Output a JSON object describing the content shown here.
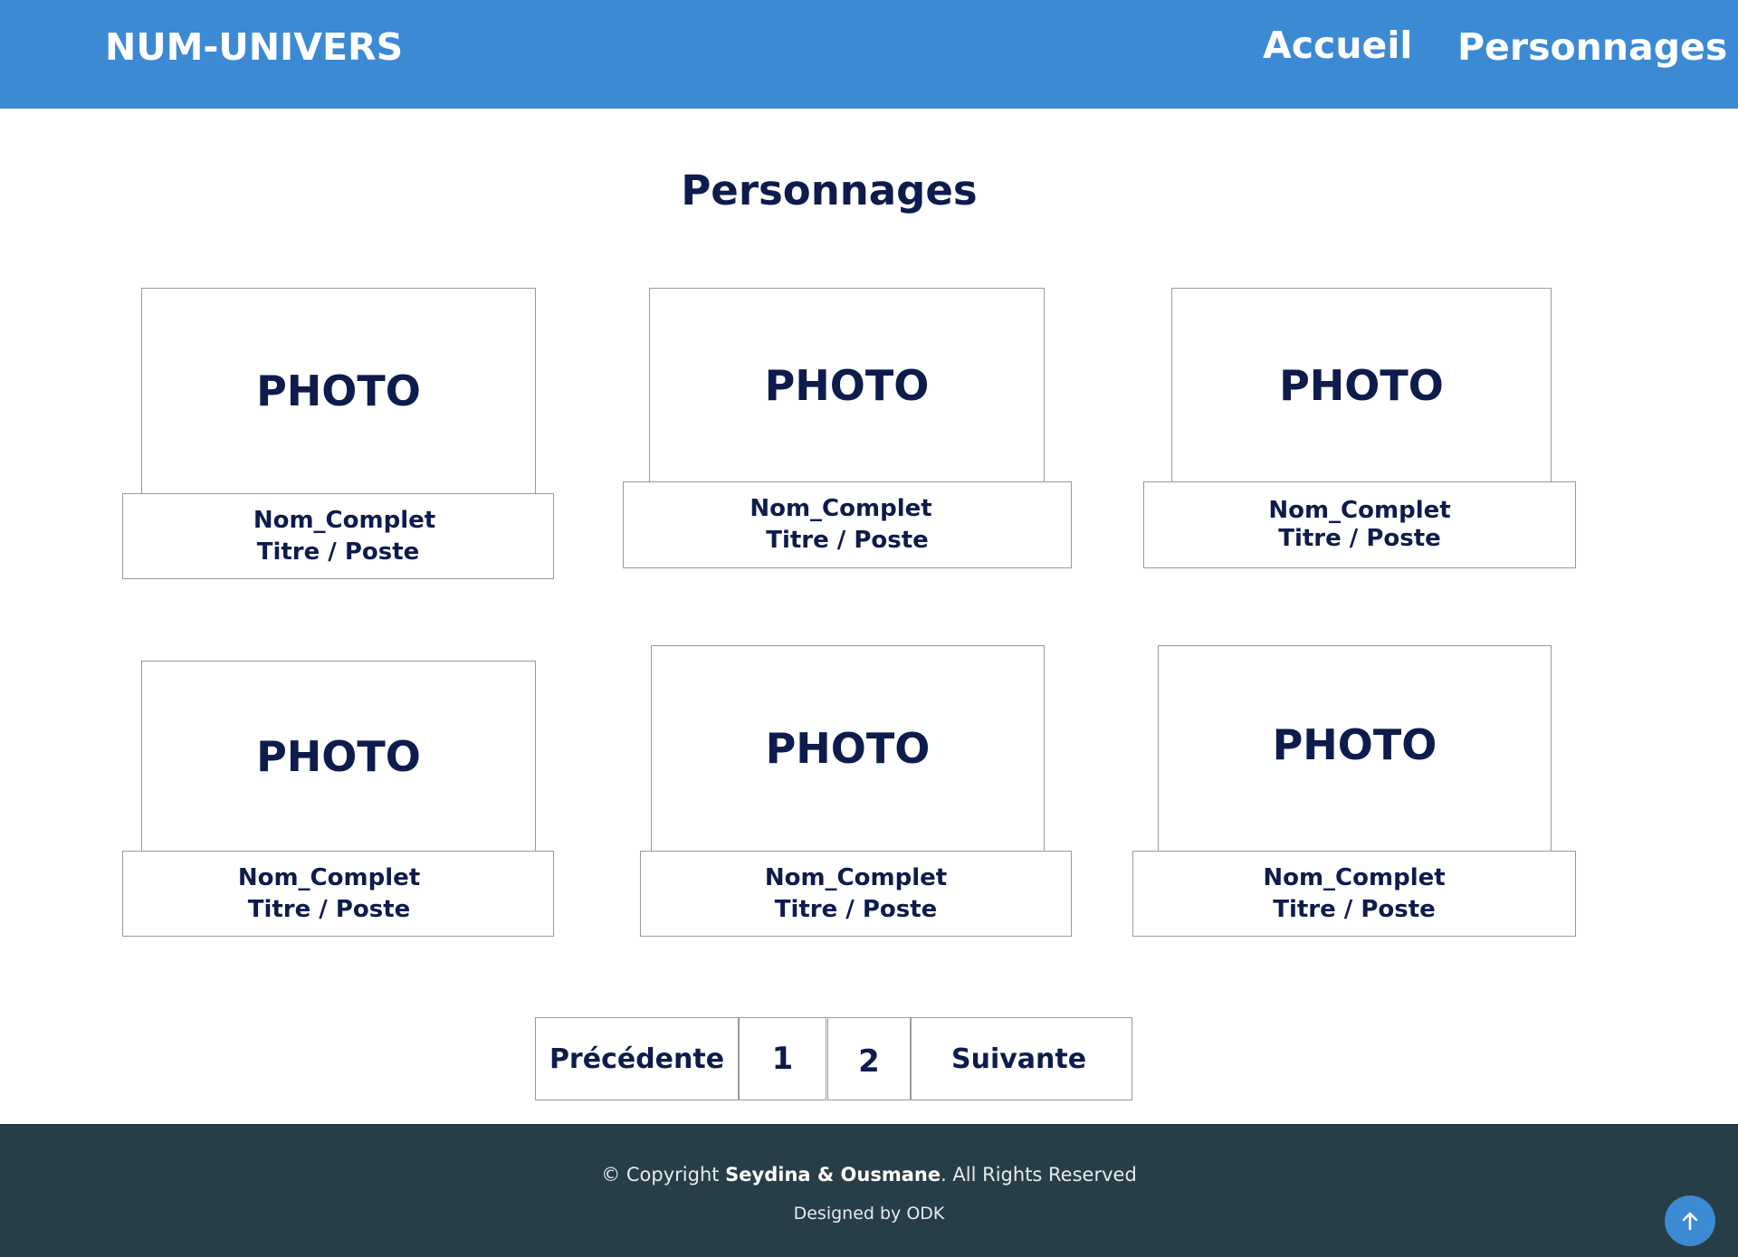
{
  "header": {
    "brand": "NUM-UNIVERS",
    "nav": [
      {
        "label": "Accueil"
      },
      {
        "label": "Personnages"
      }
    ]
  },
  "main": {
    "title": "Personnages",
    "cards": [
      {
        "photo": "PHOTO",
        "name": "Nom_Complet",
        "role": "Titre / Poste"
      },
      {
        "photo": "PHOTO",
        "name": "Nom_Complet",
        "role": "Titre / Poste"
      },
      {
        "photo": "PHOTO",
        "name": "Nom_Complet",
        "role": "Titre / Poste"
      },
      {
        "photo": "PHOTO",
        "name": "Nom_Complet",
        "role": "Titre / Poste"
      },
      {
        "photo": "PHOTO",
        "name": "Nom_Complet",
        "role": "Titre / Poste"
      },
      {
        "photo": "PHOTO",
        "name": "Nom_Complet",
        "role": "Titre / Poste"
      }
    ]
  },
  "pagination": {
    "previous": "Précédente",
    "page1": "1",
    "page2": "2",
    "next": "Suivante"
  },
  "footer": {
    "copyright_prefix": "© Copyright ",
    "authors": "Seydina & Ousmane",
    "copyright_suffix": ". All Rights Reserved",
    "designed": "Designed by ODK",
    "back_to_top_icon": "arrow-up-icon"
  },
  "colors": {
    "header_bg": "#3c8ad4",
    "text_navy": "#0e1b4d",
    "footer_bg": "#273e48"
  }
}
